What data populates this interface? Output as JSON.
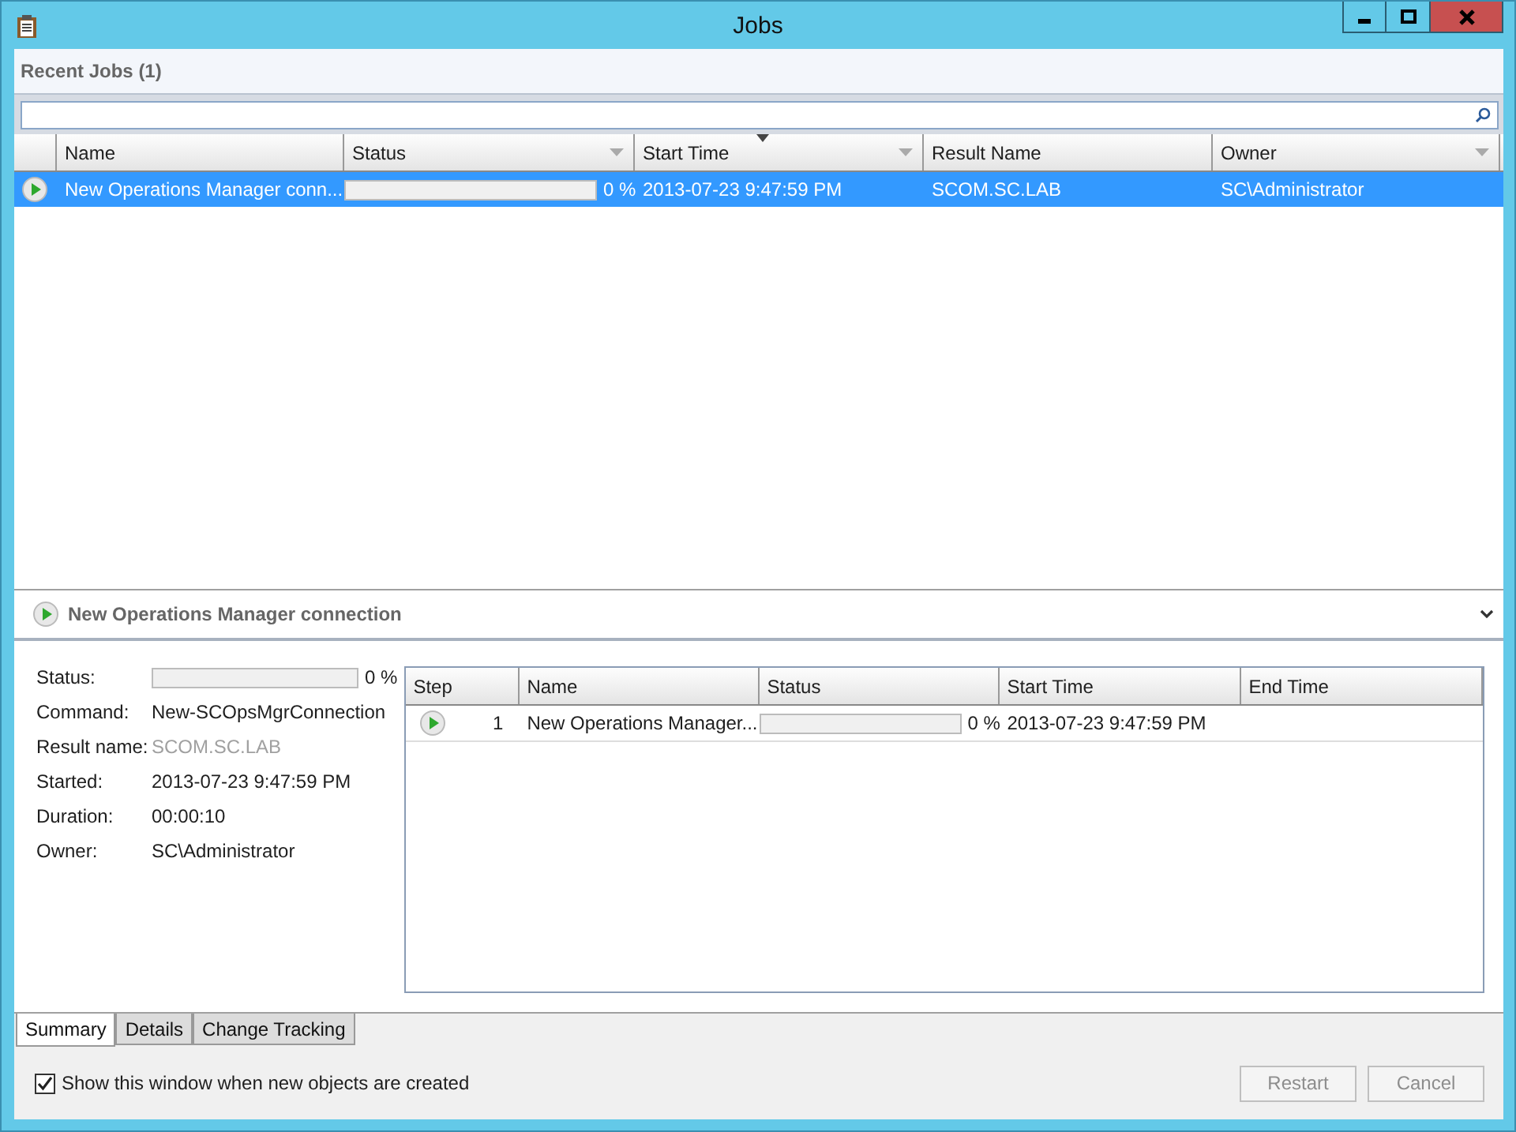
{
  "window": {
    "title": "Jobs"
  },
  "recent_jobs": {
    "title": "Recent Jobs (1)",
    "columns": [
      {
        "label": "Name",
        "filter": false,
        "sorted": false
      },
      {
        "label": "Status",
        "filter": true,
        "sorted": false
      },
      {
        "label": "Start Time",
        "filter": true,
        "sorted": true
      },
      {
        "label": "Result Name",
        "filter": false,
        "sorted": false
      },
      {
        "label": "Owner",
        "filter": true,
        "sorted": false
      }
    ],
    "rows": [
      {
        "selected": true,
        "name": "New Operations Manager conn...",
        "status": {
          "level": 0,
          "reading": "0 %"
        },
        "start_time": "2013-07-23 9:47:59 PM",
        "result_name": "SCOM.SC.LAB",
        "owner": "SC\\Administrator"
      }
    ]
  },
  "detail": {
    "title": "New Operations Manager connection",
    "properties": [
      {
        "kind": "progress",
        "label": "Status:",
        "level": 0,
        "reading": "0 %"
      },
      {
        "kind": "text",
        "label": "Command:",
        "value": "New-SCOpsMgrConnection"
      },
      {
        "kind": "dim",
        "label": "Result name:",
        "value": "SCOM.SC.LAB"
      },
      {
        "kind": "text",
        "label": "Started:",
        "value": "2013-07-23 9:47:59 PM"
      },
      {
        "kind": "text",
        "label": "Duration:",
        "value": "00:00:10"
      },
      {
        "kind": "text",
        "label": "Owner:",
        "value": "SC\\Administrator"
      }
    ],
    "steps": {
      "columns": [
        "Step",
        "Name",
        "Status",
        "Start Time",
        "End Time"
      ],
      "rows": [
        {
          "step": "1",
          "name": "New Operations Manager...",
          "status": {
            "level": 0,
            "reading": "0 %"
          },
          "start_time": "2013-07-23 9:47:59 PM"
        }
      ]
    }
  },
  "tabs": [
    {
      "label": "Summary",
      "selected": true
    },
    {
      "label": "Details",
      "selected": false
    },
    {
      "label": "Change Tracking",
      "selected": false
    }
  ],
  "footer": {
    "checkbox": {
      "label": "Show this window when new objects are created",
      "checked": true
    },
    "buttons": [
      {
        "label": "Restart",
        "disabled": true
      },
      {
        "label": "Cancel",
        "disabled": true
      }
    ]
  }
}
